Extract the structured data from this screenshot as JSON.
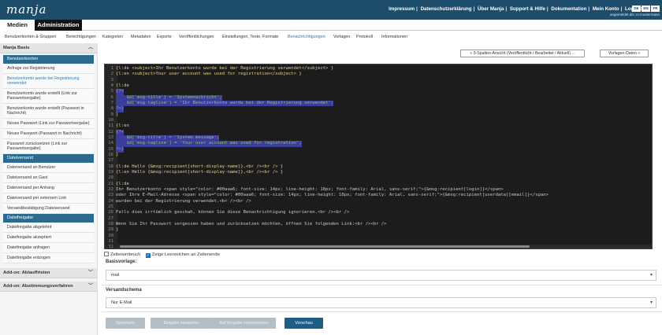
{
  "app": {
    "logo": "manja"
  },
  "top_links": [
    "Impressum",
    "Datenschutzerklärung",
    "Über Manja",
    "Support & Hilfe",
    "Dokumentation",
    "Mein Konto",
    "Logout"
  ],
  "lang_buttons": [
    "DE",
    "EN",
    "FR"
  ],
  "logged_in_as": "angemeldet als: m.mustermann",
  "main_tabs": {
    "medien": "Medien",
    "admin": "Administration"
  },
  "subnav": [
    "Benutzerkonten & Gruppen",
    "Berechtigungen",
    "Kategorien",
    "Metadaten",
    "Exporte",
    "Veröffentlichungen",
    "Einstellungen, Texte, Formate",
    "Benachrichtigungen",
    "Vorlagen",
    "Protokoll",
    "Informationen"
  ],
  "sidebar": {
    "header": "Manja Basis",
    "sections": [
      {
        "title": "Benutzerkonten",
        "items": [
          "Anfrage zur Registrierung",
          "Benutzerkonto wurde bei Registrierung verwendet",
          "Benutzerkonto wurde erstellt (Link zur Passwortvergabe)",
          "Benutzerkonto wurde erstellt (Passwort in Nachricht)",
          "Neues Passwort (Link zur Passwortvergabe)",
          "Neues Passwort (Passwort in Nachricht)",
          "Passwort zurücksetzen (Link zur Passwortvergabe)"
        ]
      },
      {
        "title": "Dateiversand",
        "items": [
          "Dateiversand an Benutzer",
          "Dateiversand an Gast",
          "Dateiversand per Anhang",
          "Dateiversand per externem Link",
          "Versandbestätigung Dateiversand"
        ]
      },
      {
        "title": "Dateifreigabe",
        "items": [
          "Dateifreigabe abgelehnt",
          "Dateifreigabe akzeptiert",
          "Dateifreigabe anfragen",
          "Dateifreigabe entzogen"
        ]
      }
    ],
    "addons": [
      "Add-on: Ablauffristen",
      "Add-on: Abstimmungsverfahren"
    ]
  },
  "content": {
    "view_button": "« 3-Spalten-Ansicht (Veröffentlicht / Bearbeitet / Aktuell) ...",
    "template_data_button": "Vorlagen-Daten »",
    "line_wrap_label": "Zeilenumbruch",
    "show_spaces_label": "Zeige Leerzeichen an Zeilenende",
    "basisvorlage_label": "Basisvorlage:",
    "basisvorlage_value": "mail",
    "versandschema_label": "Versandschema",
    "versandschema_value": "Nur E-Mail",
    "buttons": {
      "save": "Speichern",
      "revert": "Eingabe verwerfen",
      "reset": "Auf Vorgabe zurücksetzen",
      "preview": "Vorschau"
    }
  },
  "code_lines": [
    "{l:de <subject>Ihr Benutzerkonto wurde bei der Registrierung verwendet</subject> }",
    "{l:en <subject>Your user account was used for registration</subject> }",
    "",
    "{l:de",
    "{?<",
    "    $d['msg-title'] = 'Systemnachricht';",
    "    $d['msg-tagline'] = 'Ihr Benutzerkonto wurde bei der Registrierung verwendet';",
    "?>}",
    "}",
    "",
    "{l:en",
    "{?<",
    "    $d['msg-title'] = 'System message';",
    "    $d['msg-tagline'] = 'Your user account was used for registration';",
    "?>}",
    "}",
    "",
    "{l:de Hallo {&msg:recipient[short-display-name]},<br /><br /> }",
    "{l:en Hello {&msg:recipient[short-display-name]},<br /><br /> }",
    "",
    "{l:de",
    "Ihr Benutzerkonto <span style=\"color: #00aaa6; font-size: 14px; line-height: 18px; font-family: Arial, sans-serif;\">{&msg:recipient[login]}</span>",
    "oder Ihre E-Mail-Adresse <span style=\"color: #00aaa6; font-size: 14px; line-height: 18px; font-family: Arial, sans-serif;\">{&msg:recipient[userdata][email]}</span>",
    "wurden bei der Registrierung verwendet.<br /><br />",
    "",
    "Falls dies irrtümlich geschah, können Sie diese Benachrichtigung ignorieren.<br /><br />",
    "",
    "Wenn Sie Ihr Passwort vergessen haben und zurücksetzen möchten, öffnen Sie folgenden Link:<br /><br />",
    "}",
    "",
    "",
    ""
  ]
}
